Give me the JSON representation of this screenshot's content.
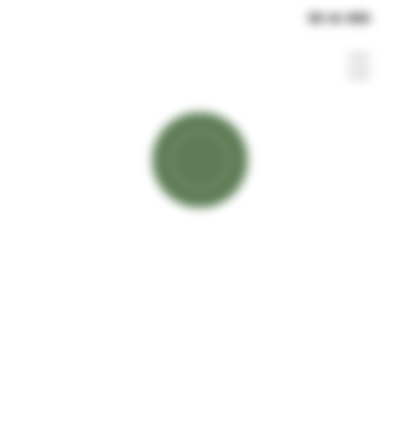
{
  "status_bar": {
    "time": "",
    "icons": [
      "signal-icon",
      "wifi-icon",
      "battery-icon"
    ]
  },
  "header": {
    "logo_text": "",
    "menu_icon": "hamburger-menu-icon"
  },
  "badge": {
    "icon": "round-green-badge-icon",
    "color": "#5d7c56"
  },
  "content": {
    "headline": "",
    "subtext": "",
    "subtext_line2": ""
  },
  "colors": {
    "background": "#ffffff",
    "accent": "#5d7c56",
    "headline": "#2e2e2e",
    "muted": "#9a9a9a"
  }
}
